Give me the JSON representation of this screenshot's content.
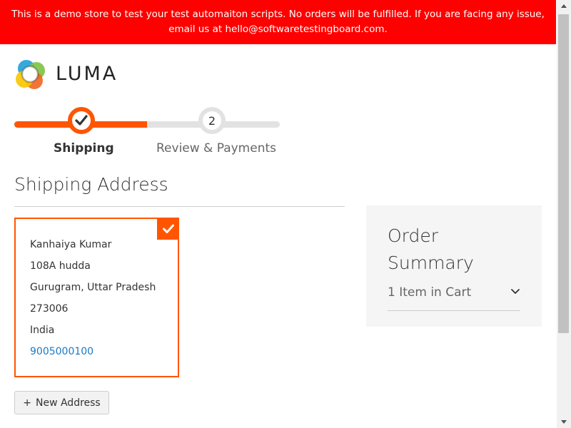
{
  "notice": {
    "text": "This is a demo store to test your test automaiton scripts. No orders will be fulfilled. If you are facing any issue, email us at hello@softwaretestingboard.com."
  },
  "logo": {
    "text": "LUMA"
  },
  "progress": {
    "steps": [
      {
        "label": "Shipping",
        "state": "complete",
        "icon": "check-icon"
      },
      {
        "label": "Review & Payments",
        "number": "2",
        "state": "pending"
      }
    ]
  },
  "shipping": {
    "title": "Shipping Address",
    "address": {
      "name": "Kanhaiya Kumar",
      "street": "108A hudda",
      "city_region": "Gurugram, Uttar Pradesh",
      "postcode": "273006",
      "country": "India",
      "phone": "9005000100",
      "selected": true
    },
    "new_address_button": {
      "icon": "+",
      "label": "New Address"
    }
  },
  "summary": {
    "title": "Order Summary",
    "items_in_cart": "1 Item in Cart",
    "expand_icon": "chevron-down-icon"
  },
  "colors": {
    "notice_bg": "#ff0000",
    "accent": "#ff5501",
    "link": "#1979c3",
    "summary_bg": "#f5f5f5"
  }
}
